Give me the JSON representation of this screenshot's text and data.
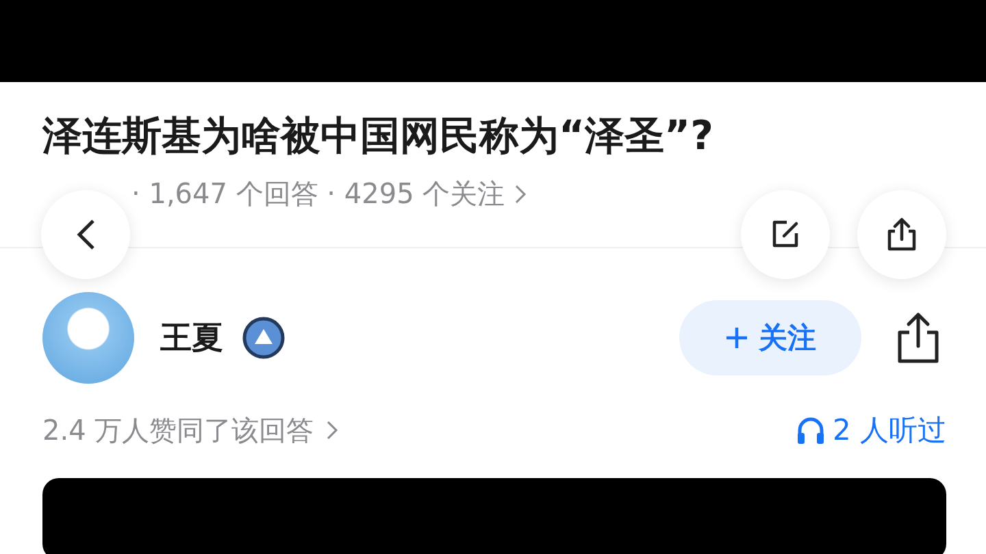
{
  "question": {
    "title": "泽连斯基为啥被中国网民称为“泽圣”?",
    "stats": "· 1,647 个回答 · 4295 个关注"
  },
  "answer": {
    "author": "王夏",
    "follow_label": "关注",
    "upvotes": "2.4 万人赞同了该回答",
    "listens": "2 人听过"
  }
}
